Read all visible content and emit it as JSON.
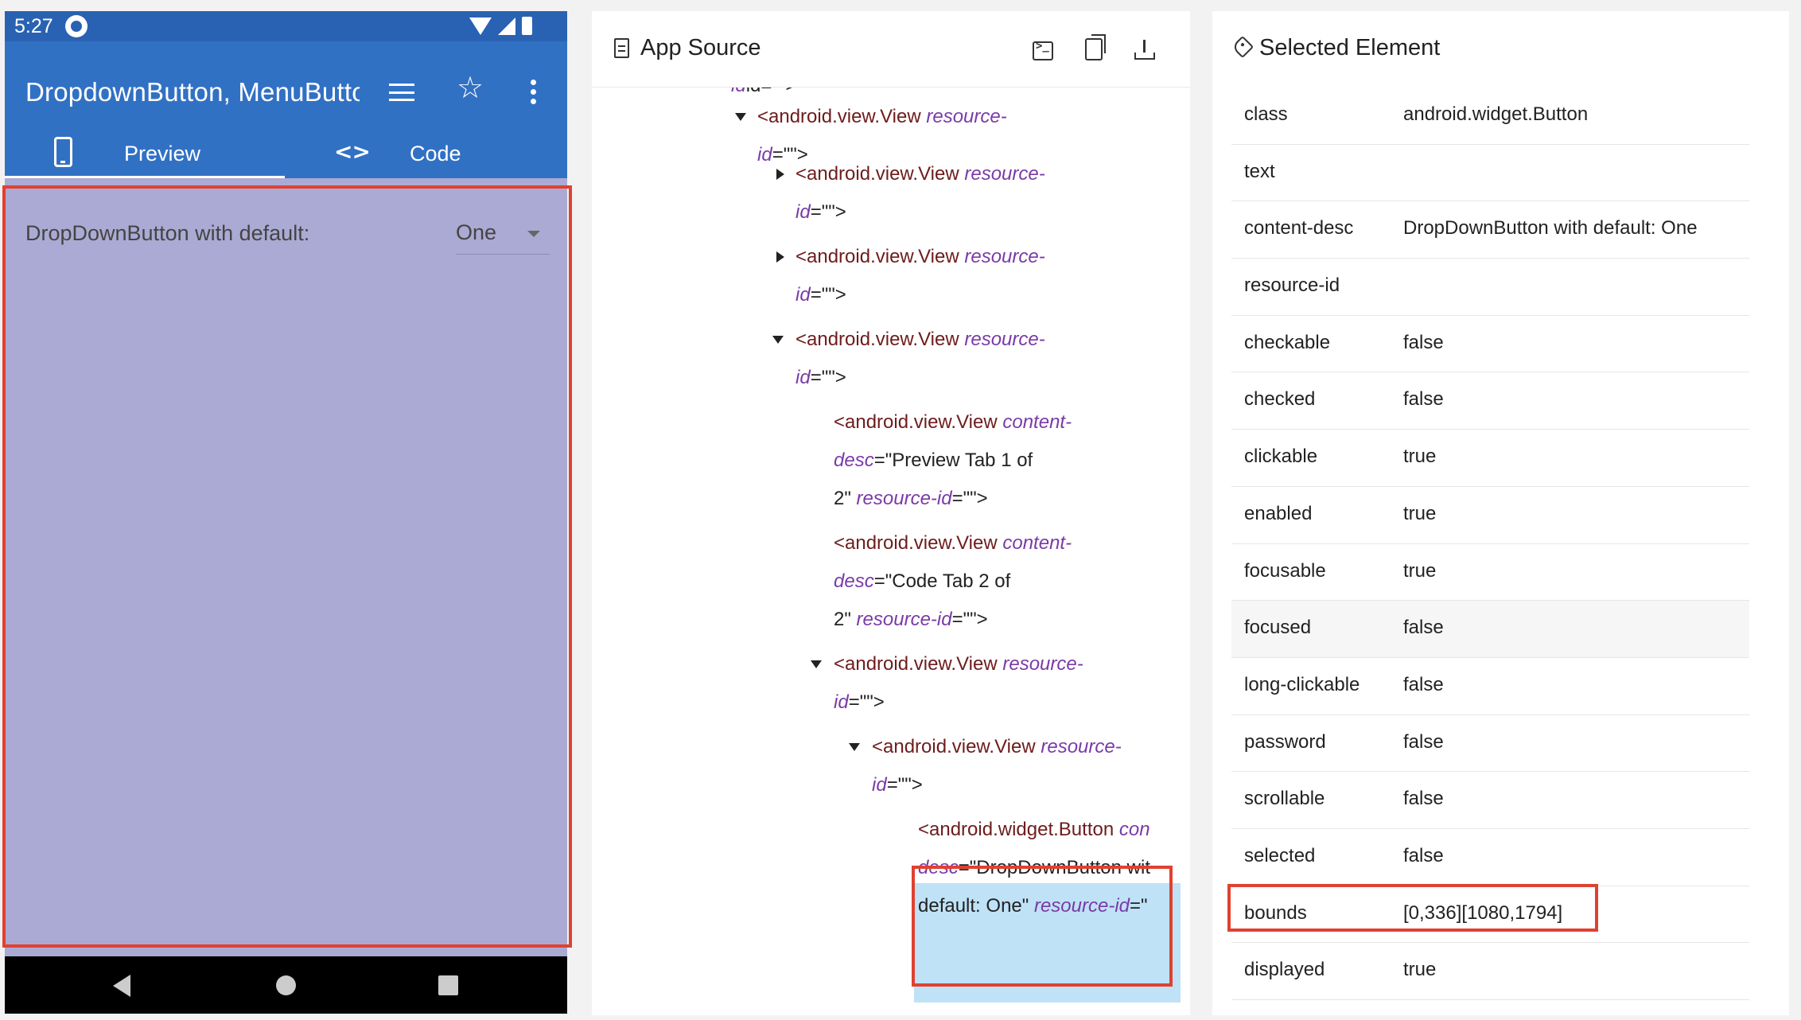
{
  "phone": {
    "status_time": "5:27",
    "app_title": "DropdownButton, MenuButton",
    "tabs": [
      {
        "label": "Preview",
        "icon": "phone-icon"
      },
      {
        "label": "Code",
        "icon": "code-icon"
      }
    ],
    "preview": {
      "label": "DropDownButton with default:",
      "dropdown_value": "One"
    },
    "highlight_color": "#e04131"
  },
  "source": {
    "title": "App Source",
    "tree": {
      "l0": "id=\"\">",
      "n1": {
        "tag": "<android.view.View",
        "attr1": "resource-",
        "attr2": "id",
        "tail": "=\"\">"
      },
      "n2": {
        "tag": "<android.view.View",
        "attr1": "resource-",
        "attr2": "id",
        "tail": "=\"\">"
      },
      "n3": {
        "tag": "<android.view.View",
        "attr1": "resource-",
        "attr2": "id",
        "tail": "=\"\">"
      },
      "n4": {
        "tag": "<android.view.View",
        "attr1": "resource-",
        "attr2": "id",
        "tail": "=\"\">"
      },
      "n5": {
        "tag": "<android.view.View",
        "attr1": "content-",
        "attr2": "desc",
        "mid": "=\"Preview Tab 1 of",
        "pre3": "2\"",
        "attr3": "resource-id",
        "tail": "=\"\">"
      },
      "n6": {
        "tag": "<android.view.View",
        "attr1": "content-",
        "attr2": "desc",
        "mid": "=\"Code Tab 2 of",
        "pre3": "2\"",
        "attr3": "resource-id",
        "tail": "=\"\">"
      },
      "n7": {
        "tag": "<android.view.View",
        "attr1": "resource-",
        "attr2": "id",
        "tail": "=\"\">"
      },
      "n8": {
        "tag": "<android.view.View",
        "attr1": "resource-",
        "attr2": "id",
        "tail": "=\"\">"
      },
      "sel": {
        "tag": "<android.widget.Button",
        "attr1": "con",
        "attr2": "desc",
        "mid": "=\"DropDownButton wit",
        "pre3": "default: One\"",
        "attr3": "resource-id",
        "tail": "=\""
      }
    }
  },
  "selected": {
    "title": "Selected Element",
    "properties": [
      {
        "key": "class",
        "value": "android.widget.Button"
      },
      {
        "key": "text",
        "value": ""
      },
      {
        "key": "content-desc",
        "value": "DropDownButton with default: One"
      },
      {
        "key": "resource-id",
        "value": ""
      },
      {
        "key": "checkable",
        "value": "false"
      },
      {
        "key": "checked",
        "value": "false"
      },
      {
        "key": "clickable",
        "value": "true"
      },
      {
        "key": "enabled",
        "value": "true"
      },
      {
        "key": "focusable",
        "value": "true"
      },
      {
        "key": "focused",
        "value": "false"
      },
      {
        "key": "long-clickable",
        "value": "false"
      },
      {
        "key": "password",
        "value": "false"
      },
      {
        "key": "scrollable",
        "value": "false"
      },
      {
        "key": "selected",
        "value": "false"
      },
      {
        "key": "bounds",
        "value": "[0,336][1080,1794]"
      },
      {
        "key": "displayed",
        "value": "true"
      }
    ]
  }
}
